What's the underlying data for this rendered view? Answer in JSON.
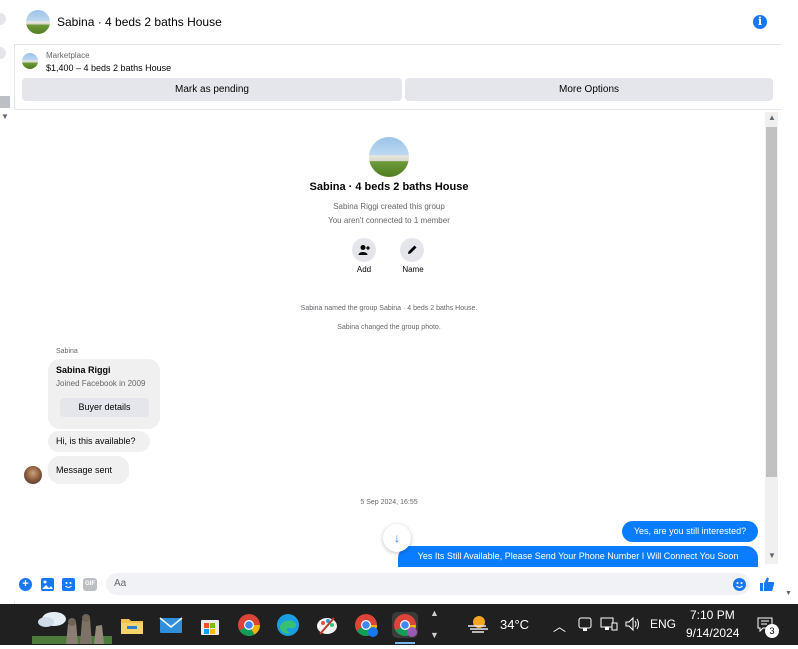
{
  "header": {
    "title": "Sabina · 4 beds 2 baths House"
  },
  "marketplace": {
    "label": "Marketplace",
    "listing": "$1,400 – 4 beds 2 baths House"
  },
  "actions": {
    "pending": "Mark as pending",
    "more": "More Options"
  },
  "group": {
    "title": "Sabina · 4 beds 2 baths House",
    "created": "Sabina Riggi created this group",
    "connected": "You aren't connected to 1 member",
    "add_label": "Add",
    "name_label": "Name",
    "event_named": "Sabina named the group Sabina · 4 beds 2 baths House.",
    "event_photo": "Sabina changed the group photo."
  },
  "messages": {
    "sender": "Sabina",
    "profile_name": "Sabina Riggi",
    "profile_joined": "Joined Facebook in 2009",
    "buyer_details": "Buyer details",
    "msg1": "Hi, is this available?",
    "msg2": "Message sent",
    "timestamp": "5 Sep 2024, 16:55",
    "reply1": "Yes, are you still interested?",
    "reply2": "Yes Its Still Available, Please Send Your Phone Number I Will Connect You Soon"
  },
  "composer": {
    "placeholder": "Aa"
  },
  "taskbar": {
    "temperature": "34°C",
    "language": "ENG",
    "time": "7:10 PM",
    "date": "9/14/2024",
    "notification_count": "3"
  },
  "colors": {
    "accent": "#1877f2",
    "bubble_blue": "#0a7cff",
    "bubble_grey": "#f0f0f0",
    "button_grey": "#e4e6eb",
    "taskbar": "#202020"
  }
}
